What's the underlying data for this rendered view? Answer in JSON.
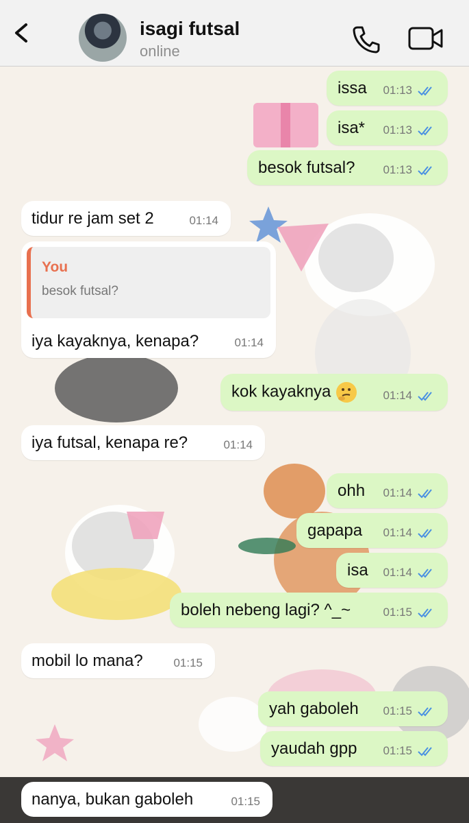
{
  "header": {
    "contact_name": "isagi futsal",
    "status": "online",
    "icons": [
      "back-icon",
      "phone-icon",
      "video-camera-icon"
    ]
  },
  "messages": [
    {
      "dir": "out",
      "text": "issa",
      "time": "01:13",
      "read": true
    },
    {
      "dir": "out",
      "text": "isa*",
      "time": "01:13",
      "read": true
    },
    {
      "dir": "out",
      "text": "besok futsal?",
      "time": "01:13",
      "read": true
    },
    {
      "dir": "in",
      "text": "tidur re jam set 2",
      "time": "01:14"
    },
    {
      "dir": "in",
      "reply_to": {
        "author": "You",
        "text": "besok futsal?"
      },
      "text": "iya kayaknya, kenapa?",
      "time": "01:14"
    },
    {
      "dir": "out",
      "text": "kok kayaknya",
      "emoji": "thinking-face",
      "time": "01:14",
      "read": true
    },
    {
      "dir": "in",
      "text": "iya futsal, kenapa re?",
      "time": "01:14"
    },
    {
      "dir": "out",
      "text": "ohh",
      "time": "01:14",
      "read": true
    },
    {
      "dir": "out",
      "text": "gapapa",
      "time": "01:14",
      "read": true
    },
    {
      "dir": "out",
      "text": "isa",
      "time": "01:14",
      "read": true
    },
    {
      "dir": "out",
      "text": "boleh nebeng lagi? ^_~",
      "time": "01:15",
      "read": true
    },
    {
      "dir": "in",
      "text": "mobil lo mana?",
      "time": "01:15"
    },
    {
      "dir": "out",
      "text": "yah gaboleh",
      "time": "01:15",
      "read": true
    },
    {
      "dir": "out",
      "text": "yaudah gpp",
      "time": "01:15",
      "read": true
    },
    {
      "dir": "in",
      "text": "nanya, bukan gaboleh",
      "time": "01:15"
    }
  ],
  "colors": {
    "outgoing_bubble": "#dcf7c5",
    "incoming_bubble": "#ffffff",
    "read_tick": "#4a90e2",
    "reply_accent": "#e8704f"
  }
}
